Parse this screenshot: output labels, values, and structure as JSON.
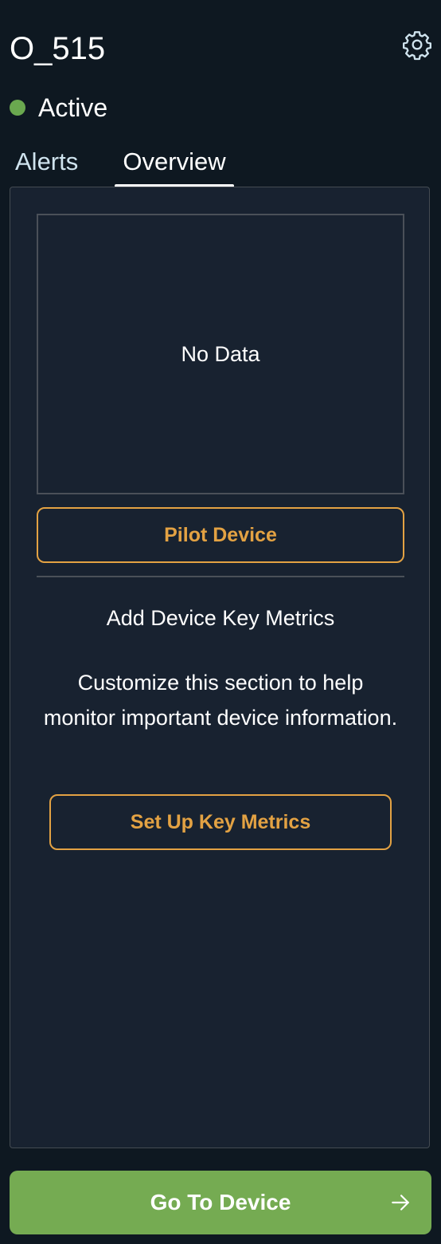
{
  "header": {
    "title": "O_515",
    "settings_icon": "gear-icon"
  },
  "status": {
    "label": "Active",
    "color": "#6aa84f"
  },
  "tabs": [
    {
      "label": "Alerts",
      "active": false
    },
    {
      "label": "Overview",
      "active": true
    }
  ],
  "overview": {
    "chart_empty_text": "No Data",
    "pilot_button_label": "Pilot Device",
    "key_metrics": {
      "title": "Add Device Key Metrics",
      "description": "Customize this section to help monitor important device information.",
      "setup_button_label": "Set Up Key Metrics"
    }
  },
  "footer": {
    "go_button_label": "Go To Device",
    "go_button_icon": "arrow-right-icon"
  },
  "colors": {
    "accent": "#e3a243",
    "primary": "#75ab52",
    "background": "#0e1821",
    "panel": "#182230"
  }
}
